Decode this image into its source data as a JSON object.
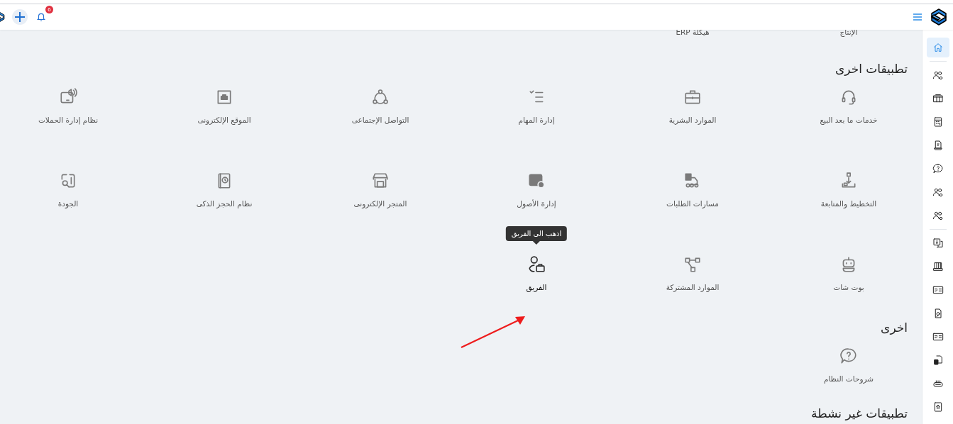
{
  "header": {
    "notification_badge": "6"
  },
  "sidebar": {
    "items": [
      {
        "selected": true
      },
      {
        "selected": false
      },
      {
        "selected": false
      },
      {
        "selected": false
      },
      {
        "selected": false
      },
      {
        "selected": false
      },
      {
        "selected": false
      },
      {
        "selected": false
      },
      {
        "selected": false
      },
      {
        "selected": false
      },
      {
        "selected": false
      },
      {
        "selected": false
      },
      {
        "selected": false
      },
      {
        "selected": false
      },
      {
        "selected": false
      },
      {
        "selected": false
      }
    ]
  },
  "partial_row": [
    "الإنتاج",
    "هيكلة ERP"
  ],
  "sections": [
    {
      "title": "تطبيقات اخرى",
      "apps": [
        {
          "label": "خدمات ما بعد البيع",
          "hovered": false
        },
        {
          "label": "الموارد البشرية",
          "hovered": false
        },
        {
          "label": "إدارة المهام",
          "hovered": false
        },
        {
          "label": "التواصل الإجتماعى",
          "hovered": false
        },
        {
          "label": "الموقع الإلكترونى",
          "hovered": false
        },
        {
          "label": "نظام إدارة الحملات",
          "hovered": false
        },
        {
          "label": "التخطيط والمتابعة",
          "hovered": false
        },
        {
          "label": "مسارات الطلبات",
          "hovered": false
        },
        {
          "label": "إدارة الأصول",
          "hovered": false
        },
        {
          "label": "المتجر الإلكترونى",
          "hovered": false
        },
        {
          "label": "نظام الحجز الذكى",
          "hovered": false
        },
        {
          "label": "الجودة",
          "hovered": false
        },
        {
          "label": "بوت شات",
          "hovered": false
        },
        {
          "label": "الموارد المشتركة",
          "hovered": false
        },
        {
          "label": "الفريق",
          "hovered": true,
          "tooltip": "اذهب الى الفريق"
        }
      ]
    },
    {
      "title": "اخرى",
      "apps": [
        {
          "label": "شروحات النظام",
          "hovered": false
        }
      ]
    },
    {
      "title": "تطبيقات غير نشطة"
    }
  ]
}
